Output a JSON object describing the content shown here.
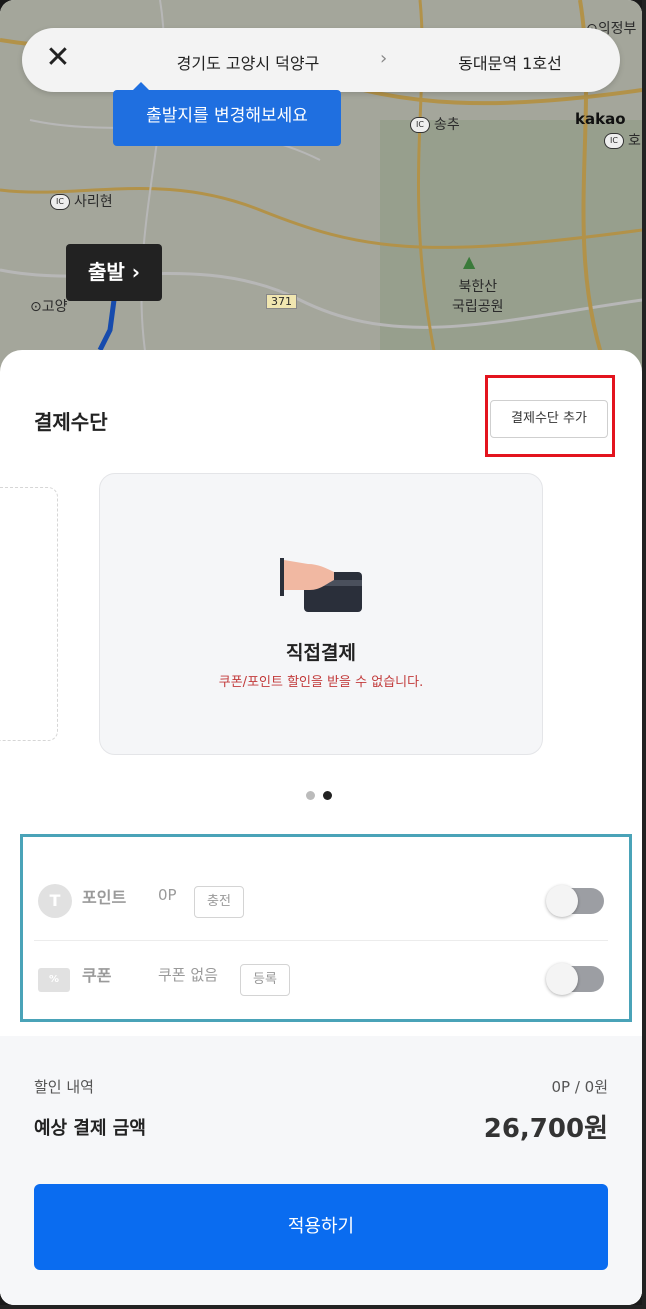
{
  "map": {
    "labels": {
      "uijeongbu": "의정부",
      "songchu": "송추",
      "sarihyeon": "사리현",
      "goyang": "고양",
      "bukhansan": "북한산",
      "national_park": "국립공원",
      "road_371": "371",
      "ho": "호",
      "ic": "IC"
    },
    "kakao": "kakao",
    "search": {
      "from": "경기도 고양시 덕양구",
      "arrow": "›",
      "to": "동대문역 1호선"
    },
    "tooltip": "출발지를 변경해보세요",
    "start_button": "출발 ›"
  },
  "sheet": {
    "title": "결제수단",
    "add_payment_label": "결제수단 추가",
    "card": {
      "title": "직접결제",
      "warning": "쿠폰/포인트 할인을 받을 수 없습니다."
    },
    "pager": {
      "total": 2,
      "active": 2
    },
    "point": {
      "icon_text": "T",
      "label": "포인트",
      "value": "0P",
      "chip": "충전",
      "enabled": false
    },
    "coupon": {
      "icon_text": "%",
      "label": "쿠폰",
      "value": "쿠폰 없음",
      "chip": "등록",
      "enabled": false
    },
    "summary": {
      "discount_label": "할인 내역",
      "discount_value": "0P / 0원",
      "estimated_label": "예상 결제 금액",
      "estimated_value": "26,700원"
    },
    "apply_label": "적용하기"
  },
  "colors": {
    "primary": "#0a6cf0",
    "tooltip": "#1f6fe0",
    "warning": "#c23b3b",
    "highlight_red": "#e3141e",
    "highlight_teal": "#4aa3b8"
  }
}
